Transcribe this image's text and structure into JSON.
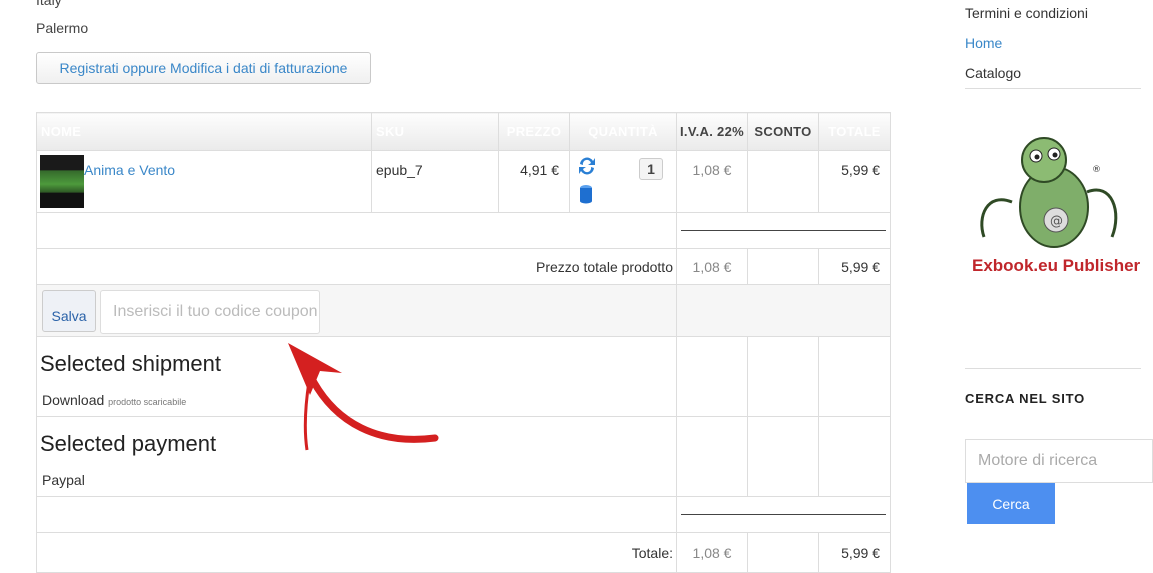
{
  "address": {
    "country": "Italy",
    "city": "Palermo"
  },
  "register_button": "Registrati oppure Modifica i dati di fatturazione",
  "cart": {
    "headers": {
      "name": "NOME",
      "sku": "SKU",
      "price": "PREZZO",
      "qty": "QUANTITÀ",
      "vat": "I.V.A. 22%",
      "discount": "SCONTO",
      "total": "TOTALE"
    },
    "item": {
      "name": "Anima e Vento",
      "sku": "epub_7",
      "price": "4,91 €",
      "qty": "1",
      "vat": "1,08 €",
      "total": "5,99 €"
    },
    "subtotal": {
      "label": "Prezzo totale prodotto",
      "vat": "1,08 €",
      "total": "5,99 €"
    },
    "coupon": {
      "save_label": "Salva",
      "placeholder": "Inserisci il tuo codice coupon"
    },
    "shipment": {
      "title": "Selected shipment",
      "method": "Download",
      "note": "prodotto scaricabile"
    },
    "payment": {
      "title": "Selected payment",
      "method": "Paypal"
    },
    "grand_total": {
      "label": "Totale:",
      "vat": "1,08 €",
      "total": "5,99 €"
    }
  },
  "sidebar": {
    "links": [
      "Termini e condizioni",
      "Home",
      "Catalogo"
    ],
    "logo_text": "Exbook.eu Publisher",
    "search_heading": "CERCA NEL SITO",
    "search_placeholder": "Motore di ricerca",
    "search_button": "Cerca"
  },
  "colors": {
    "link": "#3a87c8",
    "annotation_arrow": "#d42020",
    "search_button": "#4d8ff0"
  }
}
